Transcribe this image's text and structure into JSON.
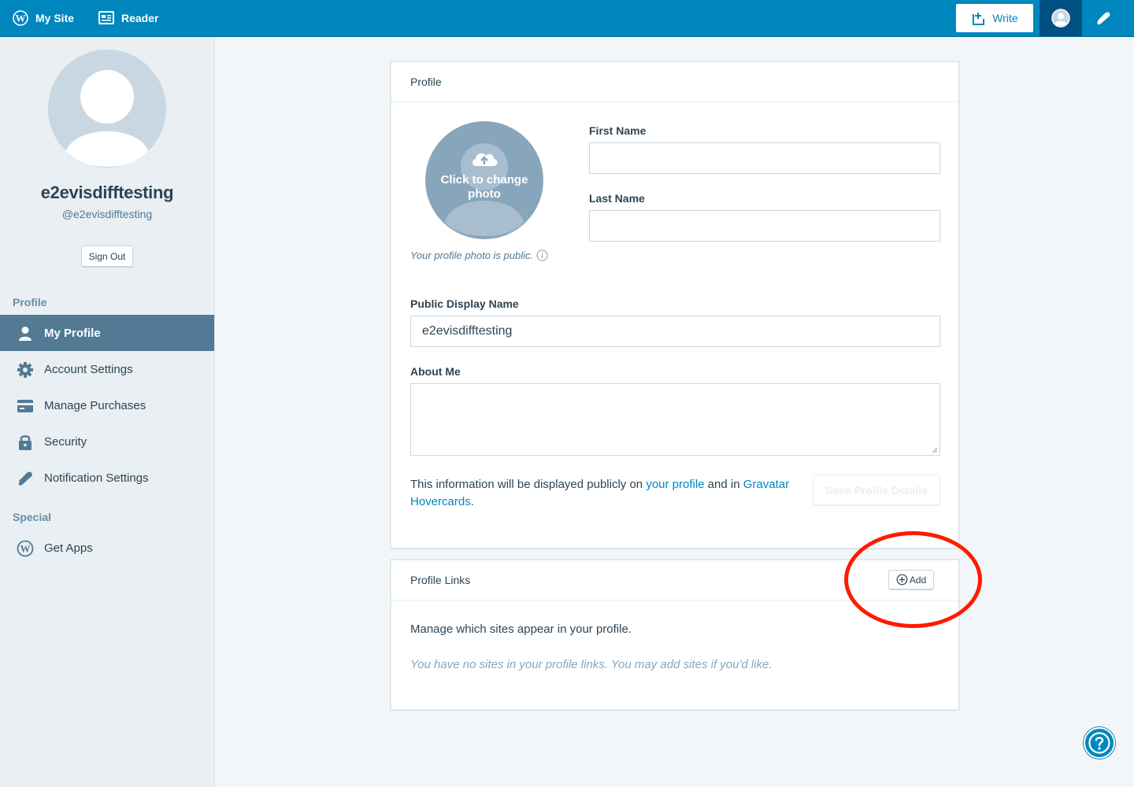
{
  "masterbar": {
    "my_site": "My Site",
    "reader": "Reader",
    "write": "Write"
  },
  "sidebar": {
    "display_name": "e2evisdifftesting",
    "username": "@e2evisdifftesting",
    "sign_out": "Sign Out",
    "profile_heading": "Profile",
    "items": [
      {
        "label": "My Profile",
        "icon": "person-icon",
        "selected": true
      },
      {
        "label": "Account Settings",
        "icon": "gear-icon"
      },
      {
        "label": "Manage Purchases",
        "icon": "credit-card-icon"
      },
      {
        "label": "Security",
        "icon": "lock-icon"
      },
      {
        "label": "Notification Settings",
        "icon": "bell-icon"
      }
    ],
    "special_heading": "Special",
    "special_items": [
      {
        "label": "Get Apps",
        "icon": "wordpress-icon"
      }
    ]
  },
  "profile_card": {
    "title": "Profile",
    "photo_text": "Click to change photo",
    "photo_note": "Your profile photo is public.",
    "first_name_label": "First Name",
    "first_name_value": "",
    "last_name_label": "Last Name",
    "last_name_value": "",
    "display_name_label": "Public Display Name",
    "display_name_value": "e2evisdifftesting",
    "about_label": "About Me",
    "about_value": "",
    "info_prefix": "This information will be displayed publicly on ",
    "info_link1": "your profile",
    "info_middle": " and in ",
    "info_link2": "Gravatar Hovercards",
    "info_suffix": ".",
    "save_button": "Save Profile Details"
  },
  "links_card": {
    "title": "Profile Links",
    "add_button": "Add",
    "manage_text": "Manage which sites appear in your profile.",
    "empty_text": "You have no sites in your profile links. You may add sites if you'd like."
  },
  "colors": {
    "masterbar": "#0087be",
    "selected_item": "#537994",
    "link": "#0087be",
    "annotation": "#ff1a00"
  }
}
